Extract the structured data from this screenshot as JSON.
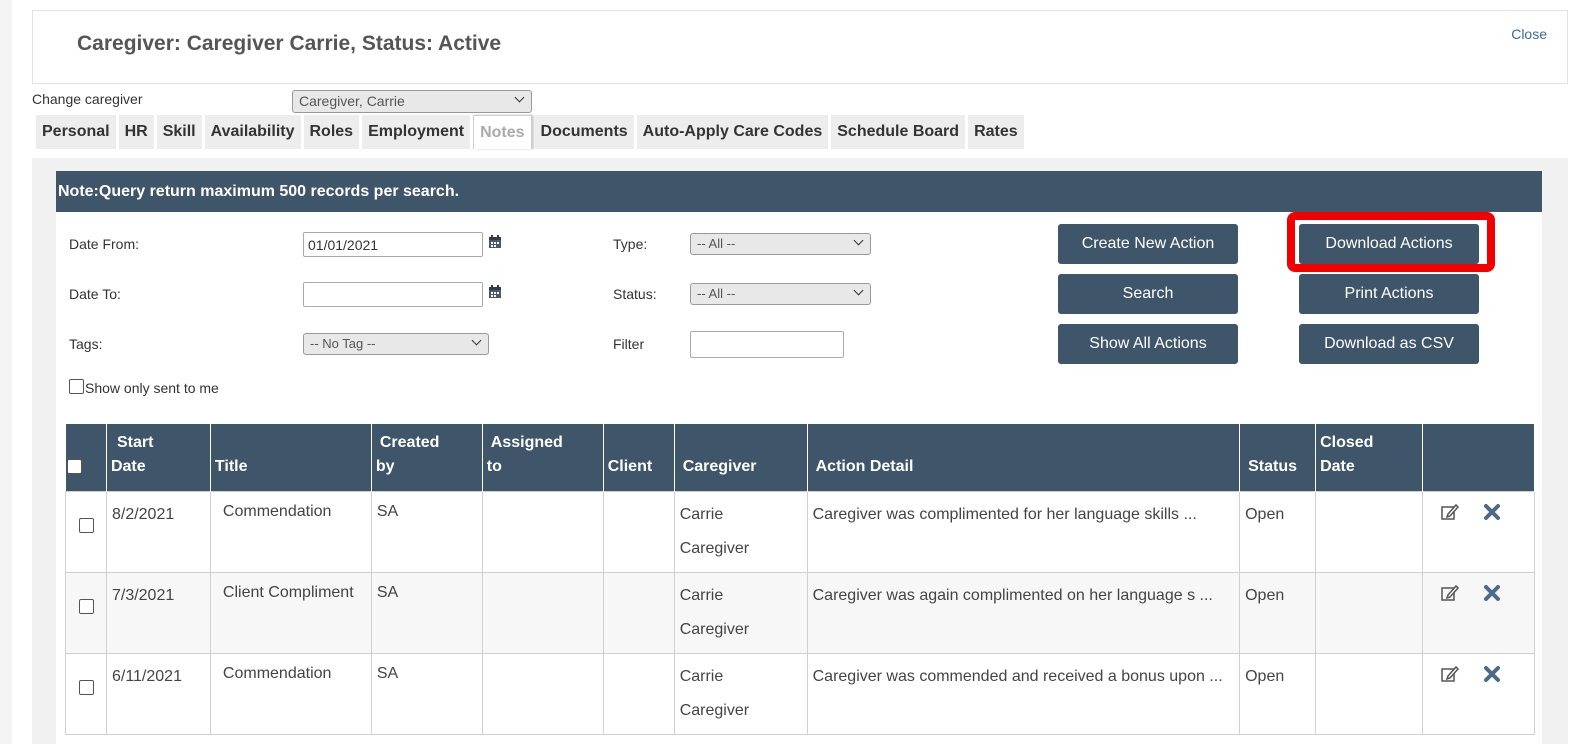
{
  "header": {
    "title": "Caregiver: Caregiver Carrie, Status: Active",
    "close_label": "Close"
  },
  "caregiver_select": {
    "label": "Change caregiver",
    "value": "Caregiver, Carrie"
  },
  "tabs": [
    {
      "label": "Personal"
    },
    {
      "label": "HR"
    },
    {
      "label": "Skill"
    },
    {
      "label": "Availability"
    },
    {
      "label": "Roles"
    },
    {
      "label": "Employment"
    },
    {
      "label": "Notes"
    },
    {
      "label": "Documents"
    },
    {
      "label": "Auto-Apply Care Codes"
    },
    {
      "label": "Schedule Board"
    },
    {
      "label": "Rates"
    }
  ],
  "note": "Note:Query return maximum 500 records per search.",
  "filters": {
    "date_from_label": "Date From:",
    "date_from_value": "01/01/2021",
    "date_to_label": "Date To:",
    "date_to_value": "",
    "tags_label": "Tags:",
    "tags_value": "-- No Tag --",
    "type_label": "Type:",
    "type_value": "-- All --",
    "status_label": "Status:",
    "status_value": "-- All --",
    "filter_label": "Filter",
    "filter_value": "",
    "show_only_label": "Show only sent to me"
  },
  "buttons": {
    "create": "Create New Action",
    "search": "Search",
    "show_all": "Show All Actions",
    "download": "Download Actions",
    "print": "Print Actions",
    "csv": "Download as CSV"
  },
  "table": {
    "headers": {
      "start_date": [
        "Start",
        "Date"
      ],
      "title": "Title",
      "created_by": [
        "Created",
        "by"
      ],
      "assigned_to": [
        "Assigned",
        "to"
      ],
      "client": "Client",
      "caregiver": "Caregiver",
      "action_detail": "Action Detail",
      "status": "Status",
      "closed_date": [
        "Closed",
        "Date"
      ]
    },
    "rows": [
      {
        "start_date": "8/2/2021",
        "title": "Commendation",
        "created_by": "SA",
        "assigned_to": "",
        "client": "",
        "caregiver": "Carrie Caregiver",
        "detail": "Caregiver was complimented for her language skills ...",
        "status": "Open",
        "closed_date": ""
      },
      {
        "start_date": "7/3/2021",
        "title": "Client Compliment",
        "created_by": "SA",
        "assigned_to": "",
        "client": "",
        "caregiver": "Carrie Caregiver",
        "detail": "Caregiver was again complimented on her language s ...",
        "status": "Open",
        "closed_date": ""
      },
      {
        "start_date": "6/11/2021",
        "title": "Commendation",
        "created_by": "SA",
        "assigned_to": "",
        "client": "",
        "caregiver": "Carrie Caregiver",
        "detail": "Caregiver was commended and received a bonus upon ...",
        "status": "Open",
        "closed_date": ""
      }
    ]
  },
  "colors": {
    "primary": "#3f5569",
    "highlight": "#f20000"
  }
}
